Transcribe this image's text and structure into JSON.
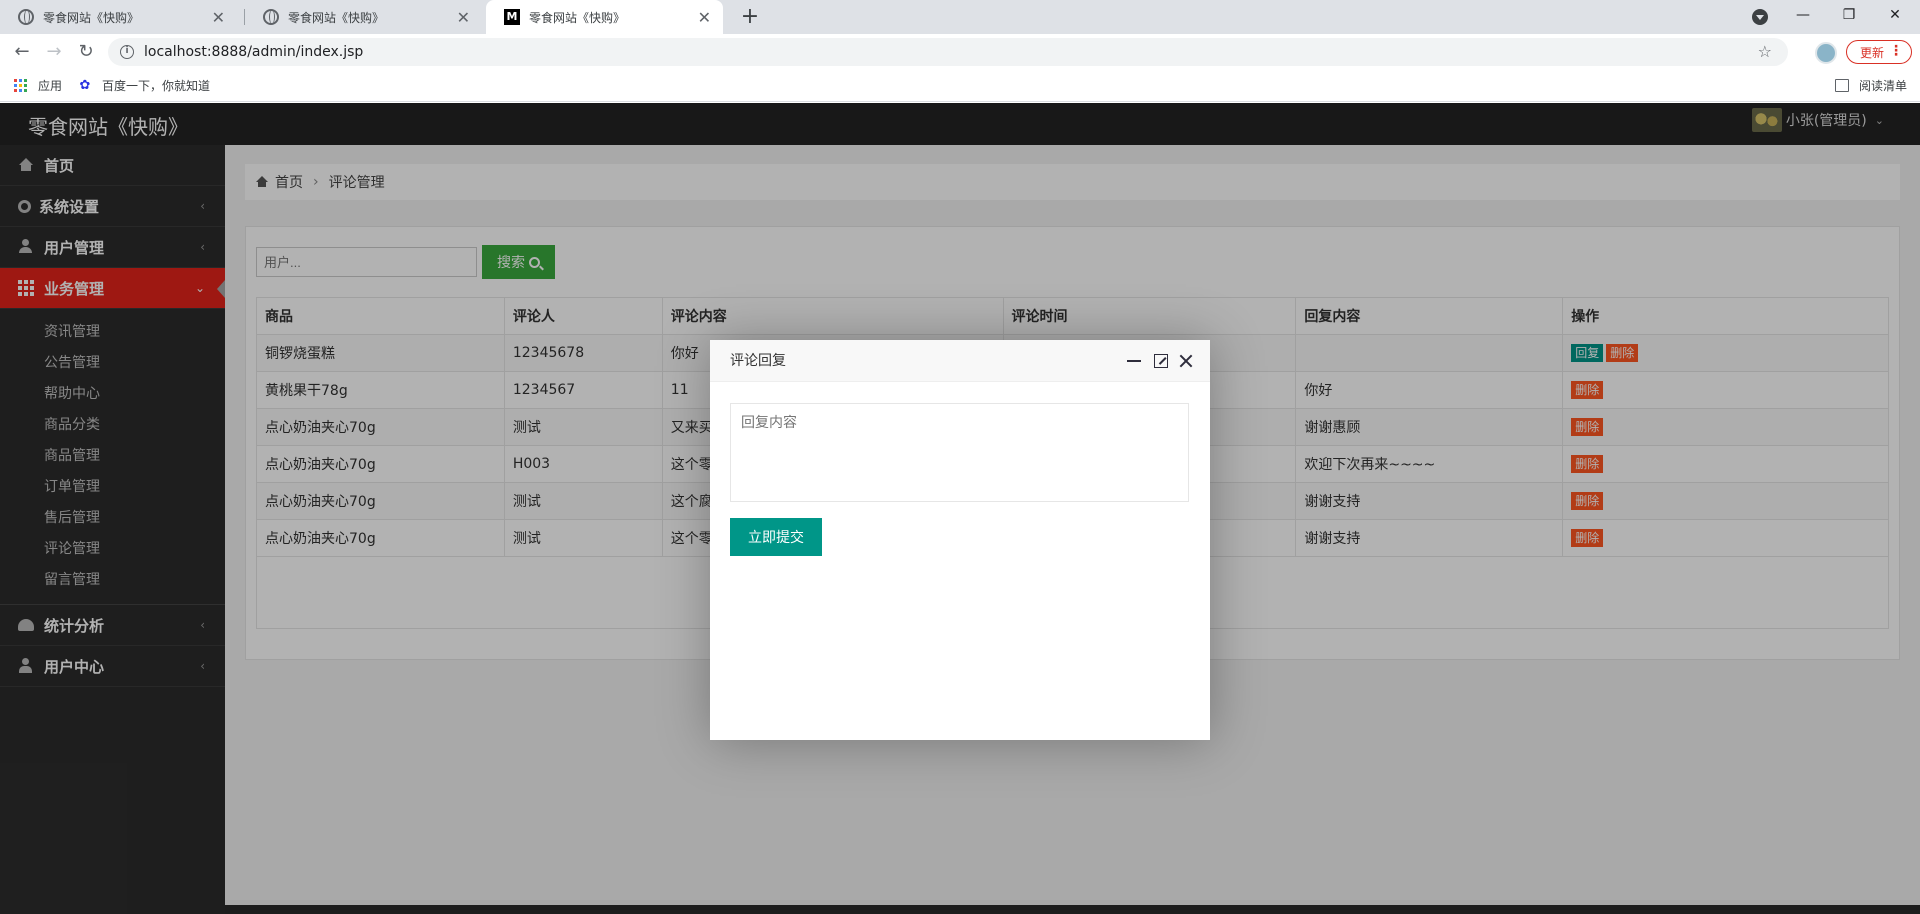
{
  "browser": {
    "tabs": [
      {
        "title": "零食网站《快购》",
        "icon": "globe-icon"
      },
      {
        "title": "零食网站《快购》",
        "icon": "globe-icon"
      },
      {
        "title": "零食网站《快购》",
        "icon": "m-favicon"
      }
    ],
    "active_tab": 2,
    "url": "localhost:8888/admin/index.jsp",
    "update_label": "更新",
    "bookmarks": {
      "apps": "应用",
      "baidu": "百度一下，你就知道",
      "reading_list": "阅读清单"
    }
  },
  "header": {
    "title": "零食网站《快购》",
    "user": "小张(管理员)"
  },
  "sidebar": {
    "items": [
      {
        "label": "首页",
        "icon": "home-icon"
      },
      {
        "label": "系统设置",
        "icon": "gears-icon",
        "arrow": "‹"
      },
      {
        "label": "用户管理",
        "icon": "user-icon",
        "arrow": "‹"
      },
      {
        "label": "业务管理",
        "icon": "grid-icon",
        "arrow": "⌄"
      },
      {
        "label": "统计分析",
        "icon": "dashboard-icon",
        "arrow": "‹"
      },
      {
        "label": "用户中心",
        "icon": "user-center-icon",
        "arrow": "‹"
      }
    ],
    "submenu": [
      "资讯管理",
      "公告管理",
      "帮助中心",
      "商品分类",
      "商品管理",
      "订单管理",
      "售后管理",
      "评论管理",
      "留言管理"
    ]
  },
  "breadcrumb": {
    "home": "首页",
    "sep": "›",
    "current": "评论管理"
  },
  "search": {
    "placeholder": "用户...",
    "button": "搜索"
  },
  "table": {
    "headers": [
      "商品",
      "评论人",
      "评论内容",
      "评论时间",
      "回复内容",
      "操作"
    ],
    "rows": [
      {
        "product": "铜锣烧蛋糕",
        "user": "12345678",
        "content": "你好",
        "time": "",
        "reply": "",
        "has_reply_btn": true
      },
      {
        "product": "黄桃果干78g",
        "user": "1234567",
        "content": "11",
        "time": "",
        "reply": "你好",
        "has_reply_btn": false
      },
      {
        "product": "点心奶油夹心70g",
        "user": "测试",
        "content": "又来买",
        "time": "",
        "reply": "谢谢惠顾",
        "has_reply_btn": false
      },
      {
        "product": "点心奶油夹心70g",
        "user": "H003",
        "content": "这个零",
        "time": "",
        "reply": "欢迎下次再来~~~~",
        "has_reply_btn": false
      },
      {
        "product": "点心奶油夹心70g",
        "user": "测试",
        "content": "这个腐",
        "time": "",
        "reply": "谢谢支持",
        "has_reply_btn": false
      },
      {
        "product": "点心奶油夹心70g",
        "user": "测试",
        "content": "这个零",
        "time": "",
        "reply": "谢谢支持",
        "has_reply_btn": false
      }
    ],
    "reply_label": "回复",
    "delete_label": "删除"
  },
  "modal": {
    "title": "评论回复",
    "placeholder": "回复内容",
    "submit": "立即提交"
  },
  "colors": {
    "header": "#232323",
    "sidebar": "#2c2c2c",
    "active": "#e2231a",
    "teal": "#009688",
    "orange": "#ff5722",
    "green": "#3aaa3e"
  }
}
